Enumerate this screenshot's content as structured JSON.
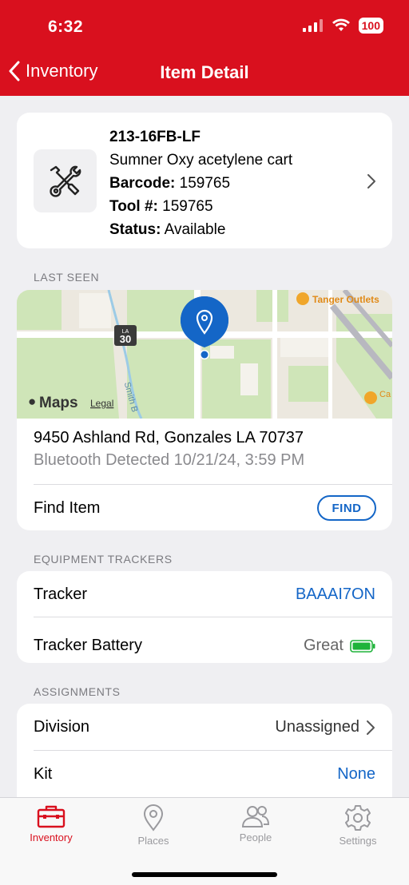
{
  "status_bar": {
    "time": "6:32",
    "battery": "100"
  },
  "nav": {
    "back_label": "Inventory",
    "title": "Item Detail"
  },
  "item": {
    "code": "213-16FB-LF",
    "name": "Sumner Oxy acetylene cart",
    "barcode_label": "Barcode:",
    "barcode": "159765",
    "tool_label": "Tool #:",
    "tool_number": "159765",
    "status_label": "Status:",
    "status": "Available"
  },
  "last_seen": {
    "section_title": "LAST SEEN",
    "map": {
      "poi_top": "Tanger Outlets",
      "poi_right": "Ca Go",
      "route_shield_top": "LA",
      "route_shield_num": "30",
      "road_label": "Smith B",
      "attribution": "Maps",
      "legal": "Legal"
    },
    "address": "9450 Ashland Rd, Gonzales LA 70737",
    "detected": "Bluetooth Detected  10/21/24, 3:59 PM",
    "find_label": "Find Item",
    "find_button": "FIND"
  },
  "trackers": {
    "section_title": "EQUIPMENT TRACKERS",
    "tracker_label": "Tracker",
    "tracker_value": "BAAAI7ON",
    "battery_label": "Tracker Battery",
    "battery_value": "Great"
  },
  "assignments": {
    "section_title": "ASSIGNMENTS",
    "division_label": "Division",
    "division_value": "Unassigned",
    "kit_label": "Kit",
    "kit_value": "None"
  },
  "tabs": [
    {
      "label": "Inventory",
      "icon": "toolbox-icon",
      "active": true
    },
    {
      "label": "Places",
      "icon": "location-pin-icon",
      "active": false
    },
    {
      "label": "People",
      "icon": "people-icon",
      "active": false
    },
    {
      "label": "Settings",
      "icon": "gear-icon",
      "active": false
    }
  ],
  "colors": {
    "brand_red": "#d9101e",
    "link_blue": "#1466c7",
    "battery_green": "#1fb33a"
  }
}
